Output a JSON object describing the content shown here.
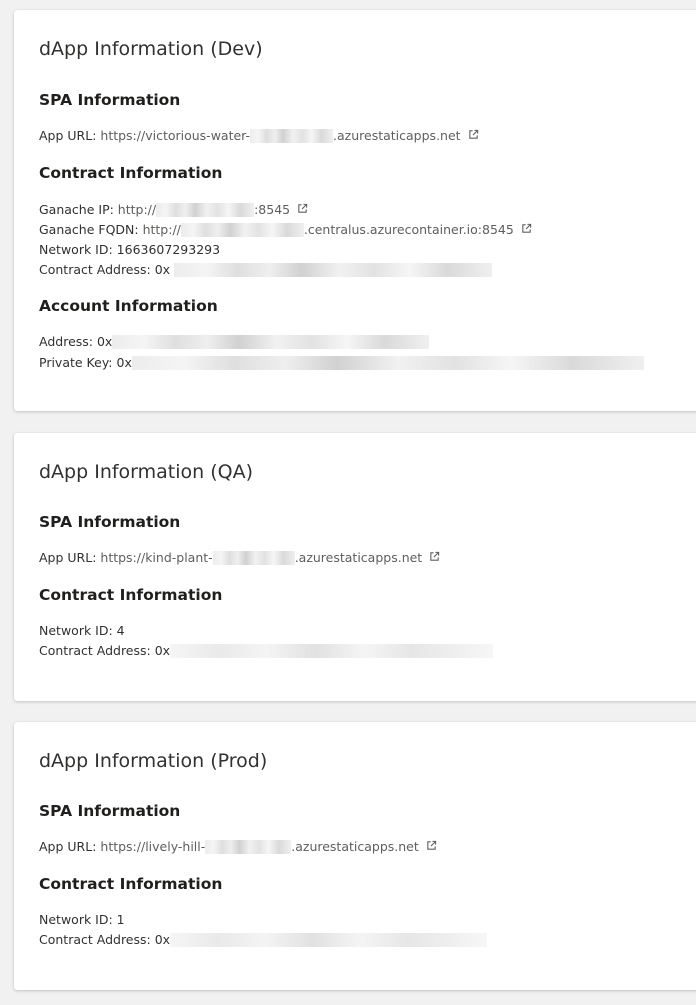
{
  "cards": [
    {
      "title": "dApp Information (Dev)",
      "spa_heading": "SPA Information",
      "app_url_label": "App URL: ",
      "app_url_prefix": "https://victorious-water-",
      "app_url_suffix": ".azurestaticapps.net",
      "contract_heading": "Contract Information",
      "ganache_ip_label": "Ganache IP: ",
      "ganache_ip_prefix": "http://",
      "ganache_ip_suffix": ":8545",
      "ganache_fqdn_label": "Ganache FQDN: ",
      "ganache_fqdn_prefix": "http://",
      "ganache_fqdn_suffix": ".centralus.azurecontainer.io:8545",
      "network_id_label": "Network ID: ",
      "network_id": "1663607293293",
      "contract_address_label": "Contract Address: ",
      "contract_address_prefix": "0x",
      "account_heading": "Account Information",
      "address_label": "Address: ",
      "address_prefix": "0x",
      "private_key_label": "Private Key: ",
      "private_key_prefix": "0x"
    },
    {
      "title": "dApp Information (QA)",
      "spa_heading": "SPA Information",
      "app_url_label": "App URL: ",
      "app_url_prefix": "https://kind-plant-",
      "app_url_suffix": ".azurestaticapps.net",
      "contract_heading": "Contract Information",
      "network_id_label": "Network ID: ",
      "network_id": "4",
      "contract_address_label": "Contract Address: ",
      "contract_address_prefix": "0x"
    },
    {
      "title": "dApp Information (Prod)",
      "spa_heading": "SPA Information",
      "app_url_label": "App URL: ",
      "app_url_prefix": "https://lively-hill-",
      "app_url_suffix": ".azurestaticapps.net",
      "contract_heading": "Contract Information",
      "network_id_label": "Network ID: ",
      "network_id": "1",
      "contract_address_label": "Contract Address: ",
      "contract_address_prefix": "0x"
    }
  ],
  "icons": {
    "external_link": "external-link-icon"
  },
  "colors": {
    "link": "#605e5c",
    "text": "#323130",
    "background": "#f1f1f1",
    "card": "#ffffff"
  }
}
